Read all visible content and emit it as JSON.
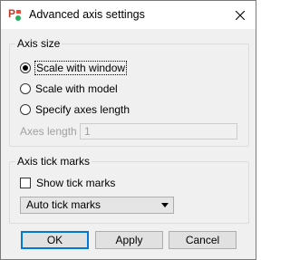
{
  "window": {
    "title": "Advanced axis settings"
  },
  "icons": {
    "app": "app-logo-icon",
    "close": "close-icon"
  },
  "axis_size": {
    "label": "Axis size",
    "options": [
      {
        "label": "Scale with window",
        "selected": true
      },
      {
        "label": "Scale with model",
        "selected": false
      },
      {
        "label": "Specify axes length",
        "selected": false
      }
    ],
    "axes_length_label": "Axes length",
    "axes_length_value": "1"
  },
  "tick_marks": {
    "label": "Axis tick marks",
    "show_label": "Show tick marks",
    "show_checked": false,
    "mode_selected": "Auto tick marks"
  },
  "buttons": {
    "ok": "OK",
    "apply": "Apply",
    "cancel": "Cancel"
  },
  "colors": {
    "accent": "#0078d7",
    "dialog_bg": "#f0f0f0"
  }
}
